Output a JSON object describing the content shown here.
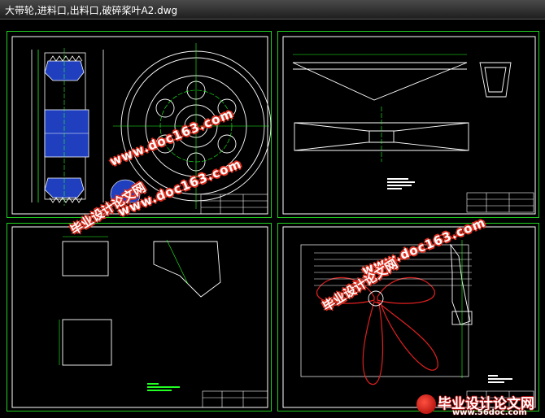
{
  "window": {
    "title": "大带轮,进料口,出料口,破碎桨叶A2.dwg"
  },
  "watermark": {
    "url": "www.doc163.com",
    "cn": "毕业设计论文网"
  },
  "brand": {
    "cn": "毕业设计论文网",
    "url": "www.56doc.com"
  },
  "colors": {
    "border": "#1fcf1f",
    "drawing_white": "#ffffff",
    "hub_blue": "#1f3fbf",
    "blade_red": "#e02020",
    "title_bg": "#2a2a2a"
  }
}
